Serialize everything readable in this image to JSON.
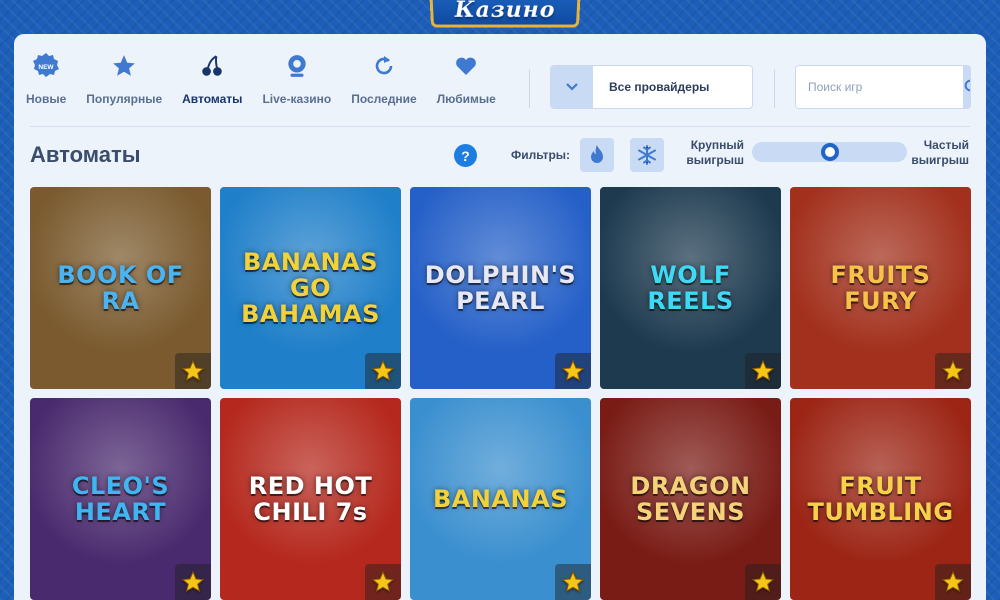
{
  "logo": {
    "text": "Казино"
  },
  "nav": [
    {
      "label": "Новые",
      "icon": "new-badge-icon"
    },
    {
      "label": "Популярные",
      "icon": "star-icon"
    },
    {
      "label": "Автоматы",
      "icon": "cherries-icon",
      "active": true
    },
    {
      "label": "Live-казино",
      "icon": "webcam-icon"
    },
    {
      "label": "Последние",
      "icon": "refresh-icon"
    },
    {
      "label": "Любимые",
      "icon": "heart-icon"
    }
  ],
  "new_badge": "NEW",
  "provider_select": {
    "value": "Все провайдеры"
  },
  "search": {
    "placeholder": "Поиск игр"
  },
  "section": {
    "title": "Автоматы",
    "help": "?"
  },
  "filters": {
    "label": "Фильтры:"
  },
  "volatility_slider": {
    "left_label": "Крупный выигрыш",
    "right_label": "Частый выигрыш",
    "value": 0.5
  },
  "games": [
    {
      "title": "BOOK OF RA",
      "bg": "#7a5a2e",
      "color": "#4ab3f0"
    },
    {
      "title": "BANANAS GO BAHAMAS",
      "bg": "#1f7fc9",
      "color": "#f2d23a"
    },
    {
      "title": "DOLPHIN'S PEARL",
      "bg": "#2560c8",
      "color": "#e8e8f4"
    },
    {
      "title": "WOLF REELS",
      "bg": "#1d3a4f",
      "color": "#3fd8f5"
    },
    {
      "title": "FRUITS FURY",
      "bg": "#a2301c",
      "color": "#f7c24a"
    },
    {
      "title": "CLEO'S HEART",
      "bg": "#4a2a6e",
      "color": "#3fb6f2"
    },
    {
      "title": "RED HOT CHILI 7s",
      "bg": "#b5281d",
      "color": "#ffffff"
    },
    {
      "title": "BANANAS",
      "bg": "#3a8fcf",
      "color": "#f2d23a"
    },
    {
      "title": "DRAGON SEVENS",
      "bg": "#7a1c16",
      "color": "#f5d27a"
    },
    {
      "title": "FRUIT TUMBLING",
      "bg": "#9c2515",
      "color": "#f7d14a"
    }
  ],
  "colors": {
    "accent": "#1e66c8",
    "panel": "#edf3fb",
    "star": "#f5c518"
  }
}
